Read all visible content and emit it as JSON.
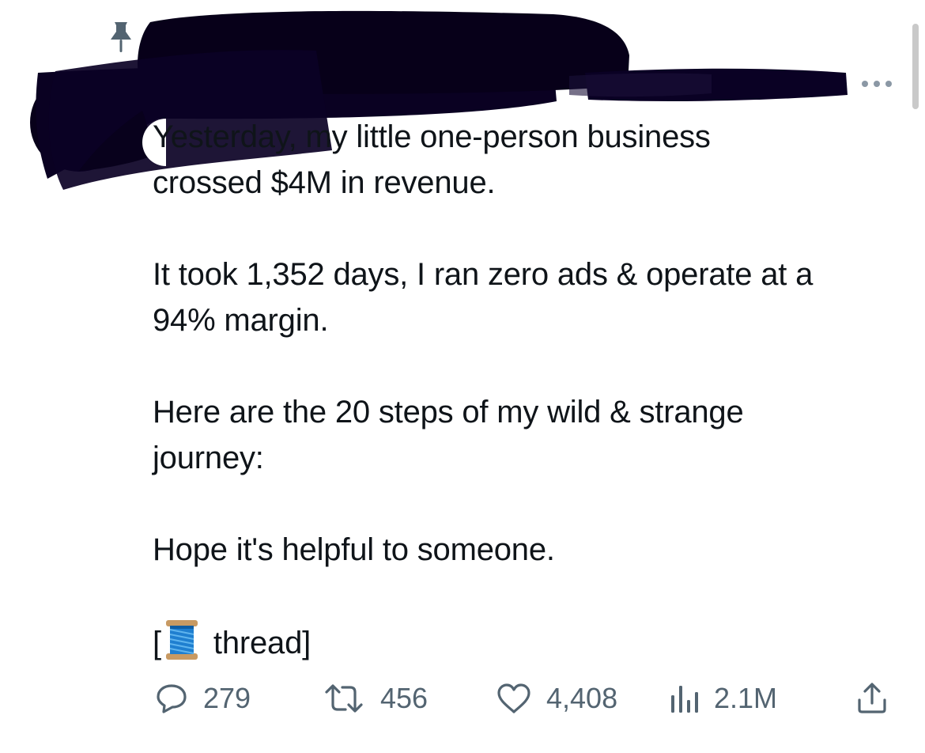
{
  "tweet": {
    "paragraphs": [
      "Yesterday, my little one-person business\ncrossed $4M in revenue.",
      "It took 1,352 days, I ran zero ads & operate at a\n94% margin.",
      "Here are the 20 steps of my wild & strange\njourney:",
      "Hope it's helpful to someone."
    ],
    "thread_open": "[",
    "thread_label": "thread]"
  },
  "actions": {
    "replies": "279",
    "reposts": "456",
    "likes": "4,408",
    "views": "2.1M"
  },
  "icons": {
    "pinned": "pin-icon",
    "more": "more-horizontal-icon",
    "reply": "reply-icon",
    "repost": "repost-icon",
    "like": "heart-icon",
    "views": "views-icon",
    "share": "share-icon",
    "thread": "spool-of-thread-emoji"
  },
  "colors": {
    "text": "#0f1419",
    "secondary": "#536471",
    "redaction": "#0c0220"
  }
}
